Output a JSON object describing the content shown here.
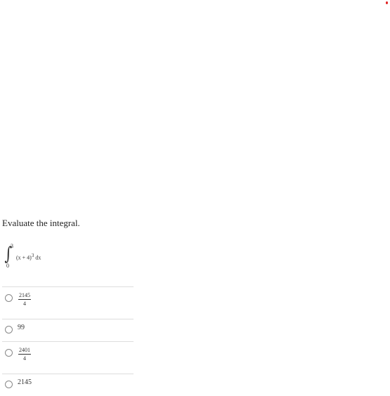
{
  "question": {
    "prompt": "Evaluate the integral.",
    "integral": {
      "sign": "∫",
      "upper_limit": "3",
      "lower_limit": "0",
      "integrand_base": "(x + 4)",
      "integrand_exponent": "3",
      "differential": "dx"
    }
  },
  "options": [
    {
      "type": "fraction",
      "numerator": "2145",
      "denominator": "4",
      "selected": false
    },
    {
      "type": "plain",
      "value": "99",
      "selected": false
    },
    {
      "type": "fraction",
      "numerator": "2401",
      "denominator": "4",
      "selected": false
    },
    {
      "type": "plain",
      "value": "2145",
      "selected": false
    }
  ],
  "colors": {
    "indicator": "#e02020",
    "divider": "#dddddd"
  }
}
